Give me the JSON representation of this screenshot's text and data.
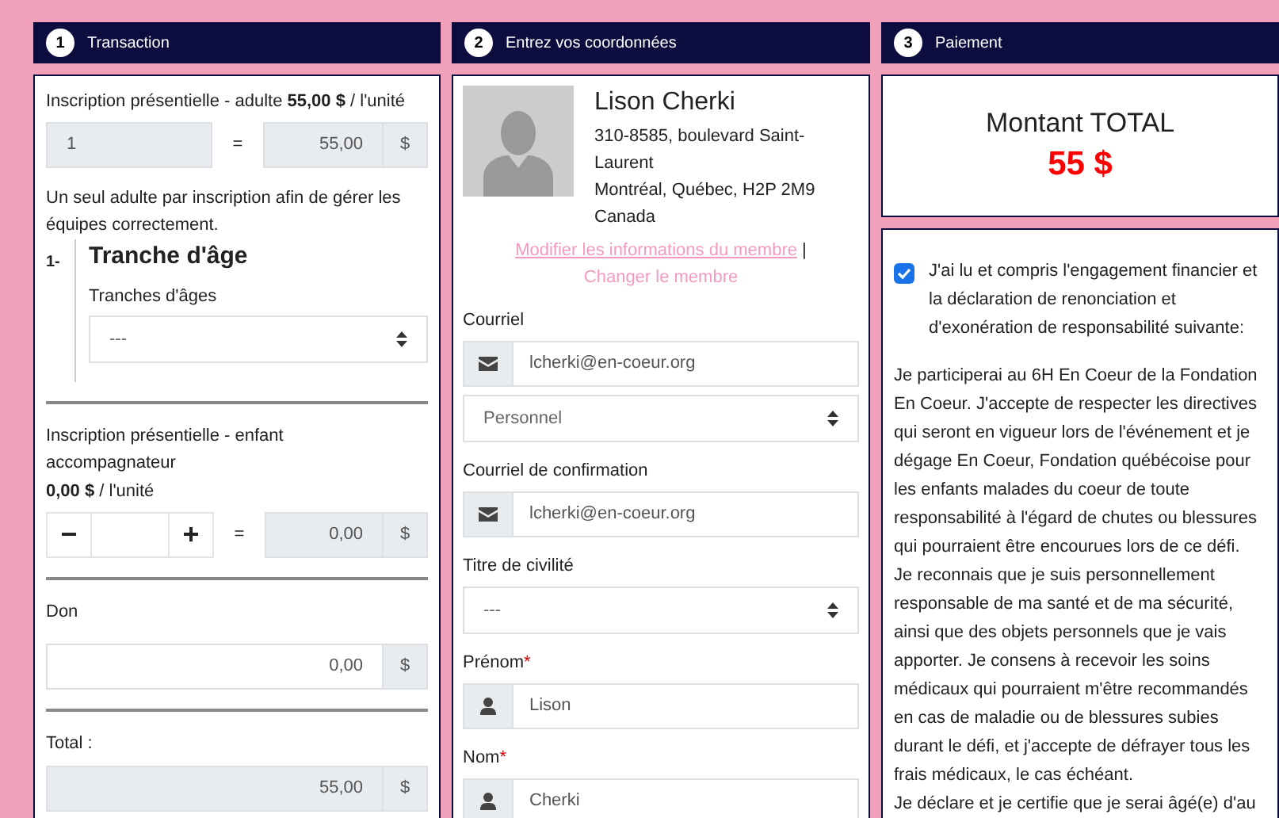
{
  "steps": [
    {
      "number": "1",
      "title": "Transaction"
    },
    {
      "number": "2",
      "title": "Entrez vos coordonnées"
    },
    {
      "number": "3",
      "title": "Paiement"
    }
  ],
  "transaction": {
    "items": [
      {
        "kind": "fixed",
        "label": "Inscription présentielle - adulte **55,00 $** / l'unité",
        "quantity": "1",
        "equals": "=",
        "amount": "55,00",
        "currency": "$",
        "note": "Un seul adulte par inscription afin de gérer les équipes correctement.",
        "group": {
          "number": "1-",
          "title": "Tranche d'âge",
          "field_label": "Tranches d'âges",
          "select_value": "---"
        }
      },
      {
        "kind": "stepper",
        "label": "Inscription présentielle - enfant accompagnateur",
        "price": "**0,00 $** / l'unité",
        "minus": "−",
        "plus": "+",
        "equals": "=",
        "amount": "0,00",
        "currency": "$"
      }
    ],
    "donation": {
      "label": "Don",
      "value": "0,00",
      "currency": "$"
    },
    "total": {
      "label": "Total :",
      "value": "55,00",
      "currency": "$"
    }
  },
  "member": {
    "name": "Lison Cherki",
    "address_lines": [
      "310-8585, boulevard Saint-Laurent",
      "Montréal, Québec, H2P 2M9",
      "Canada"
    ],
    "edit_link": "Modifier les informations du membre",
    "separator": "|",
    "change_link": "Changer le membre"
  },
  "fields": [
    {
      "kind": "email",
      "label": "Courriel",
      "value": "lcherki@en-coeur.org"
    },
    {
      "kind": "select",
      "value": "Personnel"
    },
    {
      "kind": "email",
      "label": "Courriel de confirmation",
      "value": "lcherki@en-coeur.org"
    },
    {
      "kind": "select",
      "label": "Titre de civilité",
      "value": "---"
    },
    {
      "kind": "person",
      "label": "Prénom",
      "required_mark": "*",
      "value": "Lison"
    },
    {
      "kind": "person",
      "label": "Nom",
      "required_mark": "*",
      "value": "Cherki"
    }
  ],
  "payment": {
    "total_label": "Montant TOTAL",
    "total_amount": "55 $",
    "agreement": {
      "checked": true,
      "label": "J'ai lu et compris l'engagement financier et la déclaration de renonciation et d'exonération de responsabilité suivante:"
    },
    "terms": [
      "Je participerai au 6H En Coeur de la Fondation En Coeur. J'accepte de respecter les directives qui seront en vigueur lors de l'événement et je dégage En Coeur, Fondation québécoise pour les enfants malades du coeur de toute responsabilité à l'égard de chutes ou blessures qui pourraient être encourues lors de ce défi. Je reconnais que je suis personnellement responsable de ma santé et de ma sécurité, ainsi que des objets personnels que je vais apporter. Je consens à recevoir les soins médicaux qui pourraient m'être recommandés en cas de maladie ou de blessures subies durant le défi, et j'accepte de défrayer tous les frais médicaux, le cas échéant.",
      "Je déclare et je certifie que je serai âgé(e) d'au"
    ]
  }
}
